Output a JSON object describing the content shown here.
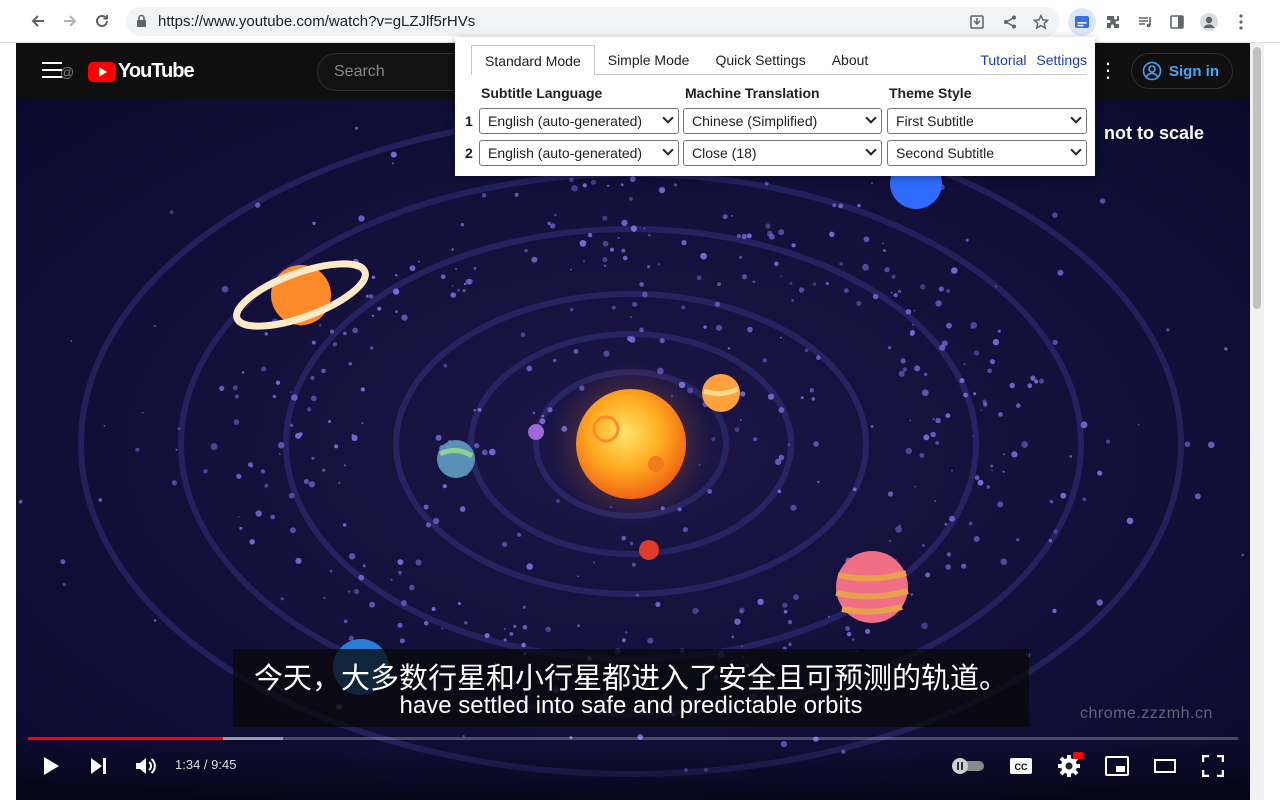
{
  "browser": {
    "url": "https://www.youtube.com/watch?v=gLZJlf5rHVs"
  },
  "youtube": {
    "logo_text": "YouTube",
    "handle_watermark": "@",
    "search_placeholder": "Search",
    "sign_in": "Sign in"
  },
  "video": {
    "overlay_text": "not to scale",
    "channel_watermark": "chrome.zzzmh.cn",
    "subtitle_primary": "今天，大多数行星和小行星都进入了安全且可预测的轨道。",
    "subtitle_secondary": "have settled into safe and predictable orbits",
    "time": "1:34 / 9:45",
    "played_fraction": 0.161,
    "buffered_fraction": 0.211
  },
  "popup": {
    "tabs": [
      "Standard Mode",
      "Simple Mode",
      "Quick Settings",
      "About"
    ],
    "active_tab": "Standard Mode",
    "links": {
      "tutorial": "Tutorial",
      "settings": "Settings"
    },
    "headers": {
      "subtitle_language": "Subtitle Language",
      "machine_translation": "Machine Translation",
      "theme_style": "Theme Style"
    },
    "rows": [
      {
        "num": "1",
        "language": "English (auto-generated)",
        "translation": "Chinese (Simplified)",
        "theme": "First Subtitle"
      },
      {
        "num": "2",
        "language": "English (auto-generated)",
        "translation": "Close (18)",
        "theme": "Second Subtitle"
      }
    ]
  },
  "colors": {
    "yt_red": "#ff0000",
    "link_blue": "#1a3ebd",
    "signin_blue": "#3ea6ff"
  }
}
